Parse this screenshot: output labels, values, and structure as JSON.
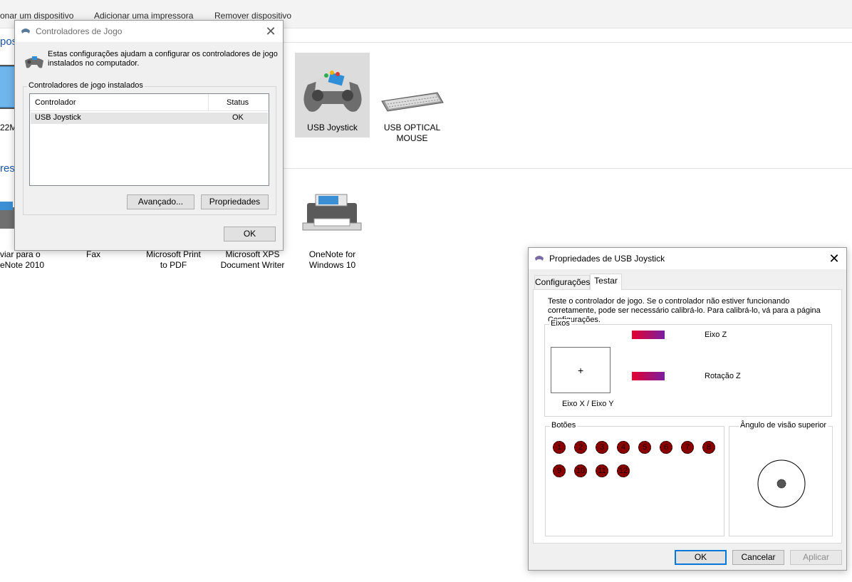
{
  "toolbar": {
    "items": [
      "onar um dispositivo",
      "Adicionar uma impressora",
      "Remover dispositivo"
    ]
  },
  "sections": {
    "devices_cut": "pos",
    "printers_cut": "ress"
  },
  "devices": [
    {
      "label": "22M",
      "icon": "laptop-icon"
    },
    {
      "label": "USB Joystick",
      "icon": "gamepad-icon",
      "selected": true
    },
    {
      "label": "USB OPTICAL\nMOUSE",
      "icon": "keyboard-icon"
    }
  ],
  "printers": [
    {
      "label": "viar para o\neNote 2010",
      "icon": "printer-icon"
    },
    {
      "label": "Fax",
      "icon": "fax-icon"
    },
    {
      "label": "Microsoft Print\nto PDF",
      "icon": "printer-icon"
    },
    {
      "label": "Microsoft XPS\nDocument Writer",
      "icon": "printer-icon"
    },
    {
      "label": "OneNote for\nWindows 10",
      "icon": "printer-icon"
    }
  ],
  "controllers_dialog": {
    "title": "Controladores de Jogo",
    "description": "Estas configurações ajudam a configurar os controladores de jogo instalados no computador.",
    "group_label": "Controladores de jogo instalados",
    "columns": [
      "Controlador",
      "Status"
    ],
    "rows": [
      {
        "name": "USB Joystick",
        "status": "OK"
      }
    ],
    "advanced_label": "Avançado...",
    "properties_label": "Propriedades",
    "ok_label": "OK"
  },
  "props_dialog": {
    "title": "Propriedades de USB Joystick",
    "tabs": [
      "Configurações",
      "Testar"
    ],
    "active_tab": "Testar",
    "instructions": "Teste o controlador de jogo. Se o controlador não estiver funcionando corretamente, pode ser necessário calibrá-lo. Para calibrá-lo, vá para a página Configurações.",
    "axes": {
      "group_label": "Eixos",
      "xy_label": "Eixo X / Eixo Y",
      "xy_marker": "+",
      "z_axis_label": "Eixo Z",
      "z_rotation_label": "Rotação Z"
    },
    "buttons": {
      "group_label": "Botões",
      "labels": [
        "1",
        "2",
        "3",
        "4",
        "5",
        "6",
        "7",
        "8",
        "9",
        "10",
        "11",
        "12"
      ]
    },
    "pov": {
      "group_label": "Ângulo de visão superior"
    },
    "ok_label": "OK",
    "cancel_label": "Cancelar",
    "apply_label": "Aplicar"
  },
  "colors": {
    "accent": "#0078d7",
    "button_pressed_red": "#8a0000",
    "section_blue": "#1e5aa8"
  }
}
